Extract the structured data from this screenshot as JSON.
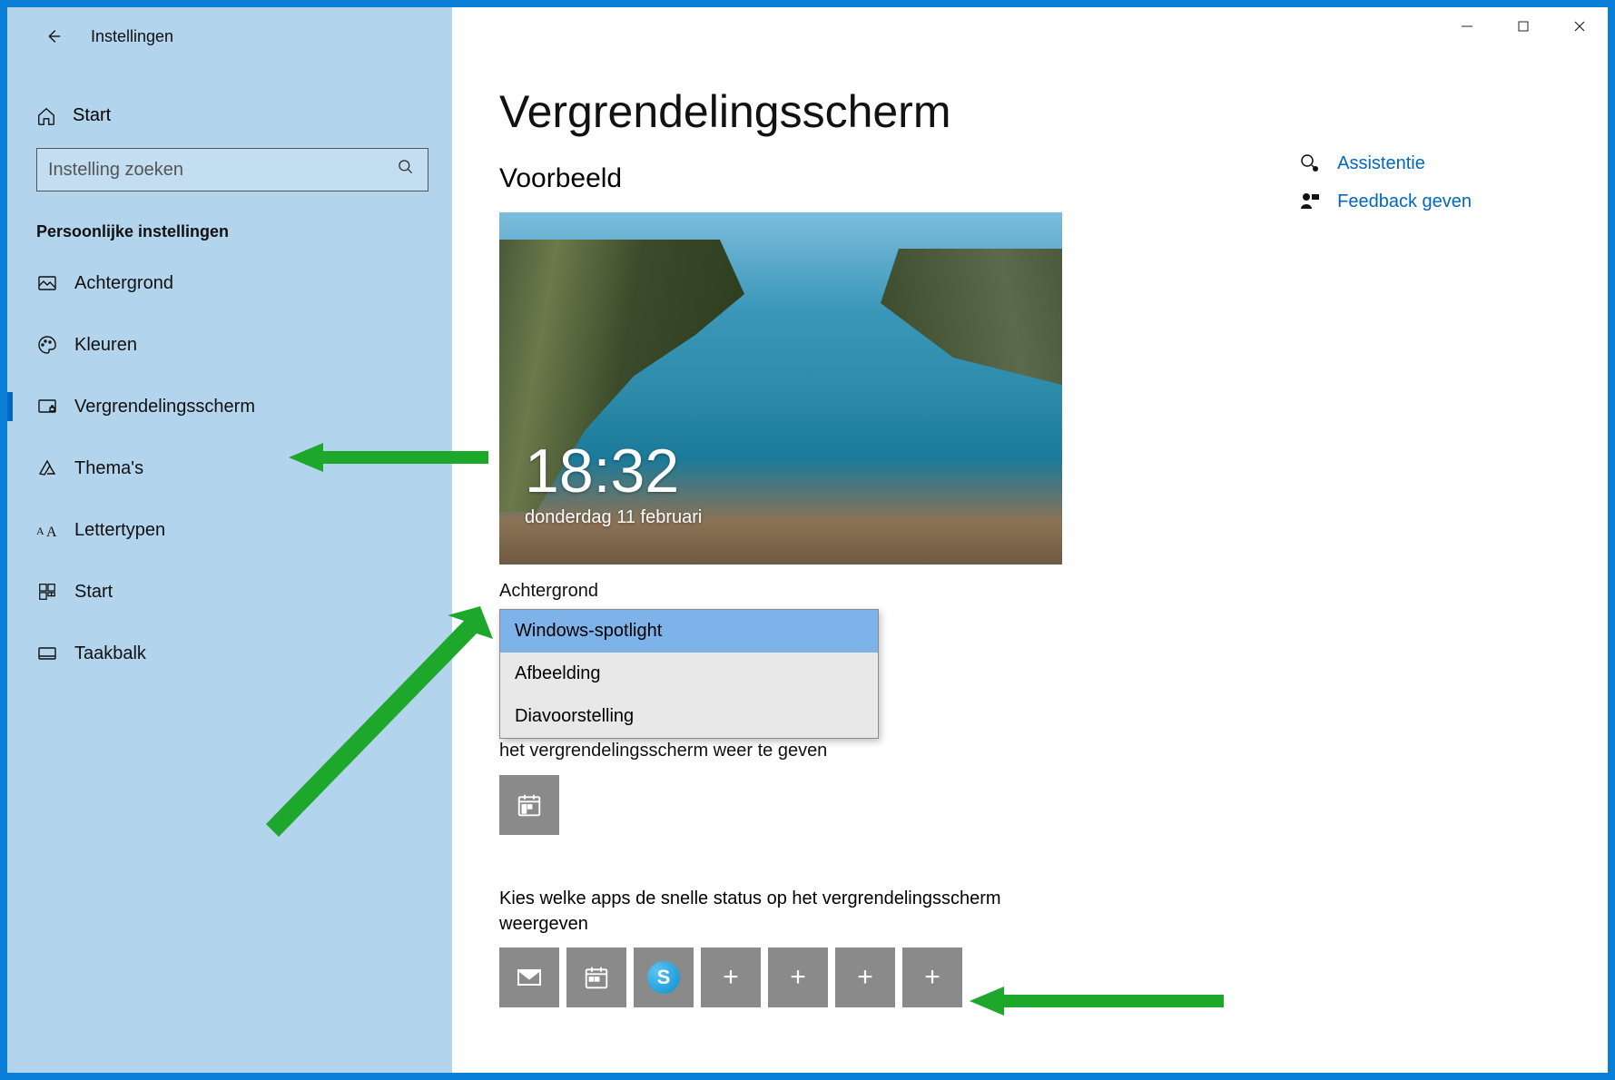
{
  "app_title": "Instellingen",
  "sidebar": {
    "home_label": "Start",
    "search_placeholder": "Instelling zoeken",
    "category": "Persoonlijke instellingen",
    "items": [
      {
        "label": "Achtergrond"
      },
      {
        "label": "Kleuren"
      },
      {
        "label": "Vergrendelingsscherm"
      },
      {
        "label": "Thema's"
      },
      {
        "label": "Lettertypen"
      },
      {
        "label": "Start"
      },
      {
        "label": "Taakbalk"
      }
    ]
  },
  "page": {
    "title": "Vergrendelingsscherm",
    "preview_label": "Voorbeeld",
    "preview_time": "18:32",
    "preview_date": "donderdag 11 februari",
    "background_label": "Achtergrond",
    "dropdown": {
      "options": [
        "Windows-spotlight",
        "Afbeelding",
        "Diavoorstelling"
      ],
      "selected": "Windows-spotlight"
    },
    "detailed_status_text_tail": "het vergrendelingsscherm weer te geven",
    "quick_status_label": "Kies welke apps de snelle status op het vergrendelingsscherm weergeven"
  },
  "right_links": {
    "assist": "Assistentie",
    "feedback": "Feedback geven"
  },
  "quick_tiles": {
    "mail": "mail-icon",
    "calendar": "calendar-icon",
    "skype": "S",
    "plus": "+"
  }
}
